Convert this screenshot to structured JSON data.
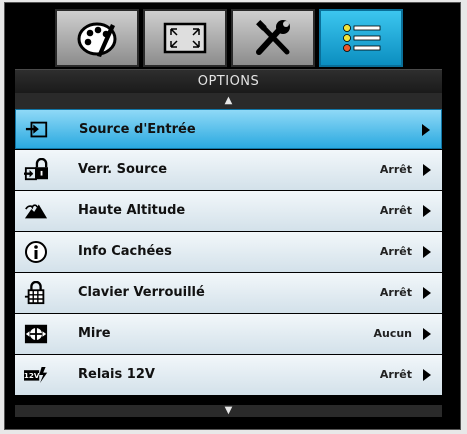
{
  "tabs": [
    {
      "icon": "palette-icon",
      "active": false
    },
    {
      "icon": "screen-resize-icon",
      "active": false
    },
    {
      "icon": "tools-icon",
      "active": false
    },
    {
      "icon": "list-options-icon",
      "active": true
    }
  ],
  "title": "OPTIONS",
  "scroll": {
    "up": "▲",
    "down": "▼"
  },
  "items": [
    {
      "icon": "input-source-icon",
      "label": "Source d'Entrée",
      "value": ""
    },
    {
      "icon": "source-lock-icon",
      "label": "Verr. Source",
      "value": "Arrêt"
    },
    {
      "icon": "high-altitude-icon",
      "label": "Haute Altitude",
      "value": "Arrêt"
    },
    {
      "icon": "info-icon",
      "label": "Info Cachées",
      "value": "Arrêt"
    },
    {
      "icon": "keypad-lock-icon",
      "label": "Clavier Verrouillé",
      "value": "Arrêt"
    },
    {
      "icon": "test-pattern-icon",
      "label": "Mire",
      "value": "Aucun"
    },
    {
      "icon": "12v-trigger-icon",
      "label": "Relais 12V",
      "value": "Arrêt"
    }
  ],
  "selected_index": 0
}
